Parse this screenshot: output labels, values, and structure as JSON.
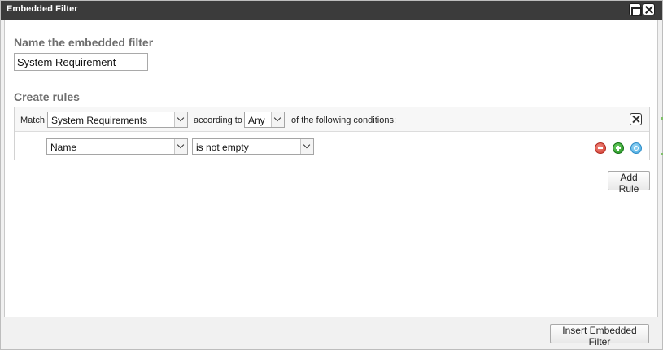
{
  "window": {
    "title": "Embedded Filter"
  },
  "name_section": {
    "heading": "Name the embedded filter",
    "value": "System Requirement"
  },
  "rules_section": {
    "heading": "Create rules",
    "match_label": "Match",
    "entity_select": "System Requirements",
    "according_label": "according to",
    "any_select": "Any",
    "following_label": "of the following conditions:",
    "rule": {
      "field": "Name",
      "operator": "is not empty"
    }
  },
  "buttons": {
    "add_rule": "Add Rule",
    "insert": "Insert Embedded Filter"
  },
  "icons": {
    "minimize": "minimize-icon",
    "close": "close-icon",
    "remove_rule": "remove-rule-icon",
    "add_rule": "add-rule-icon",
    "add_group": "add-group-icon"
  },
  "colors": {
    "titlebar": "#3b3b3b",
    "remove": "#d2392c",
    "add": "#1f8f1c",
    "group": "#3fa6e0"
  }
}
